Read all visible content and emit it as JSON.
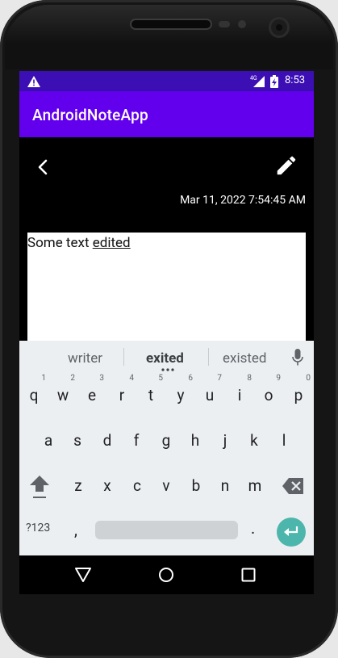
{
  "status_bar": {
    "time": "8:53",
    "network_label": "4G",
    "icons": [
      "warning-icon",
      "signal-icon",
      "battery-icon"
    ]
  },
  "app_bar": {
    "title": "AndroidNoteApp",
    "color": "#6200ee"
  },
  "note_toolbar": {
    "icons": [
      "back-arrow-icon",
      "pencil-edit-icon"
    ]
  },
  "note": {
    "date": "Mar 11, 2022 7:54:45 AM",
    "text_plain": "Some text ",
    "text_underlined": "edited"
  },
  "keyboard": {
    "suggestions": [
      "writer",
      "exited",
      "existed"
    ],
    "row1": [
      {
        "key": "q",
        "hint": "1"
      },
      {
        "key": "w",
        "hint": "2"
      },
      {
        "key": "e",
        "hint": "3"
      },
      {
        "key": "r",
        "hint": "4"
      },
      {
        "key": "t",
        "hint": "5"
      },
      {
        "key": "y",
        "hint": "6"
      },
      {
        "key": "u",
        "hint": "7"
      },
      {
        "key": "i",
        "hint": "8"
      },
      {
        "key": "o",
        "hint": "9"
      },
      {
        "key": "p",
        "hint": "0"
      }
    ],
    "row2": [
      "a",
      "s",
      "d",
      "f",
      "g",
      "h",
      "j",
      "k",
      "l"
    ],
    "row3": [
      "z",
      "x",
      "c",
      "v",
      "b",
      "n",
      "m"
    ],
    "symbols_label": "?123",
    "comma": ",",
    "period": ".",
    "accent_color": "#4db6ac"
  },
  "nav_bar": {
    "icons": [
      "nav-back-icon",
      "nav-home-icon",
      "nav-recents-icon"
    ]
  }
}
